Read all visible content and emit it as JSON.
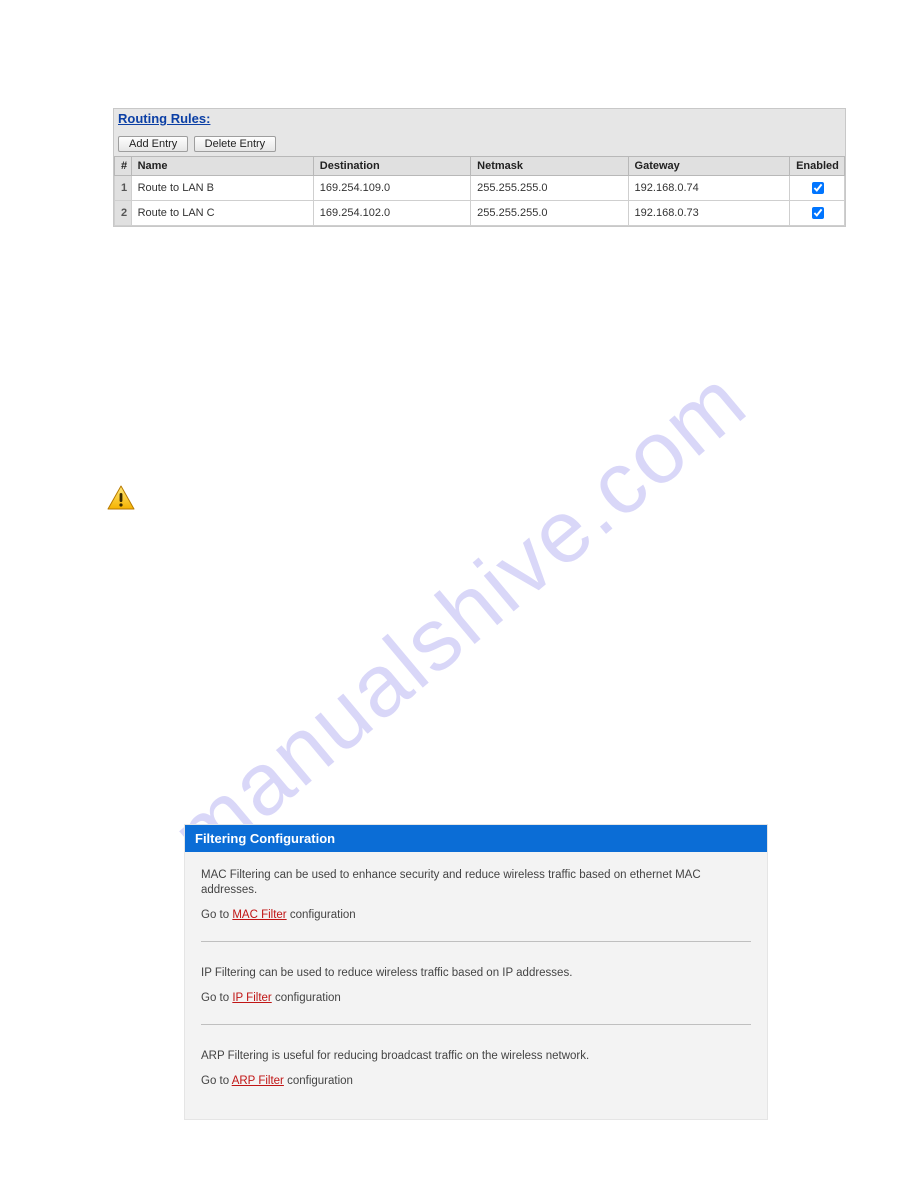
{
  "watermark": "manualshive.com",
  "routing": {
    "title": "Routing Rules:",
    "buttons": {
      "add": "Add Entry",
      "delete": "Delete Entry"
    },
    "columns": {
      "idx": "#",
      "name": "Name",
      "dest": "Destination",
      "mask": "Netmask",
      "gw": "Gateway",
      "en": "Enabled"
    },
    "rows": [
      {
        "idx": "1",
        "name": "Route to LAN B",
        "dest": "169.254.109.0",
        "mask": "255.255.255.0",
        "gw": "192.168.0.74",
        "enabled": true
      },
      {
        "idx": "2",
        "name": "Route to LAN C",
        "dest": "169.254.102.0",
        "mask": "255.255.255.0",
        "gw": "192.168.0.73",
        "enabled": true
      }
    ]
  },
  "warning_icon": "warning",
  "filtering": {
    "header": "Filtering Configuration",
    "mac_desc": "MAC Filtering can be used to enhance security and reduce wireless traffic based on ethernet MAC addresses.",
    "mac_prefix": "Go to ",
    "mac_link": "MAC Filter",
    "mac_suffix": " configuration",
    "ip_desc": "IP Filtering can be used to reduce wireless traffic based on IP addresses.",
    "ip_prefix": "Go to ",
    "ip_link": "IP Filter",
    "ip_suffix": " configuration",
    "arp_desc": "ARP Filtering is useful for reducing broadcast traffic on the wireless network.",
    "arp_prefix": "Go to ",
    "arp_link": "ARP Filter",
    "arp_suffix": " configuration"
  }
}
